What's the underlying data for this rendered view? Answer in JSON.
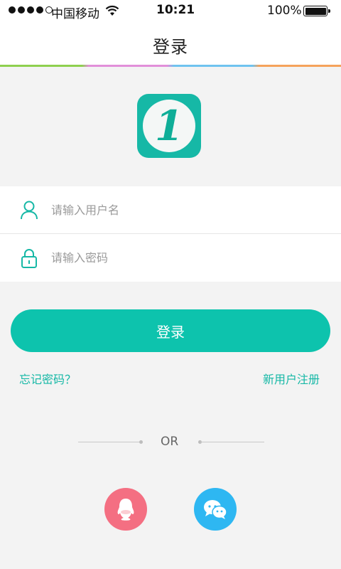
{
  "status_bar": {
    "carrier": "中国移动",
    "time": "10:21",
    "battery": "100%"
  },
  "header": {
    "title": "登录"
  },
  "logo": {
    "text": "1"
  },
  "form": {
    "username_placeholder": "请输入用户名",
    "password_placeholder": "请输入密码",
    "username_value": "",
    "password_value": ""
  },
  "actions": {
    "login_label": "登录",
    "forgot_password": "忘记密码？",
    "register": "新用户注册"
  },
  "divider": {
    "text": "OR"
  },
  "social": {
    "qq_icon": "qq-icon",
    "wechat_icon": "wechat-icon"
  },
  "colors": {
    "accent": "#0dc3ad",
    "qq": "#f46f82",
    "wechat": "#2eb7f2"
  }
}
